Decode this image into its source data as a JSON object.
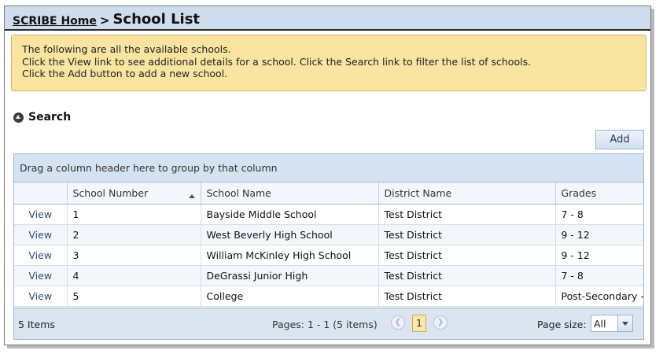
{
  "breadcrumb": {
    "home": "SCRIBE Home",
    "separator": ">",
    "current": "School List"
  },
  "info_lines": [
    "The following are all the available schools.",
    "Click the View link to see additional details for a school. Click the Search link to filter the list of schools.",
    "Click the Add button to add a new school."
  ],
  "search": {
    "label": "Search",
    "icon": "collapse-up-circle-icon"
  },
  "add_button": "Add",
  "grid": {
    "group_hint": "Drag a column header here to group by that column",
    "columns": [
      "School Number",
      "School Name",
      "District Name",
      "Grades"
    ],
    "sorted_column": "School Number",
    "sort_direction": "ascending",
    "rows": [
      {
        "action": "View",
        "number": "1",
        "name": "Bayside Middle School",
        "district": "Test District",
        "grades": "7 - 8"
      },
      {
        "action": "View",
        "number": "2",
        "name": "West Beverly High School",
        "district": "Test District",
        "grades": "9 - 12"
      },
      {
        "action": "View",
        "number": "3",
        "name": "William McKinley High School",
        "district": "Test District",
        "grades": "9 - 12"
      },
      {
        "action": "View",
        "number": "4",
        "name": "DeGrassi Junior High",
        "district": "Test District",
        "grades": "7 - 8"
      },
      {
        "action": "View",
        "number": "5",
        "name": "College",
        "district": "Test District",
        "grades": "Post-Secondary - "
      }
    ]
  },
  "pager": {
    "items": "5 Items",
    "pages_info": "Pages: 1 - 1 (5 items)",
    "current_page": "1",
    "page_size_label": "Page size:",
    "page_size_value": "All"
  },
  "colors": {
    "header_bg": "#cfdcee",
    "info_bg": "#f9e4a0",
    "grid_border": "#9fb6d2",
    "current_page_bg": "#fbe7a7"
  }
}
